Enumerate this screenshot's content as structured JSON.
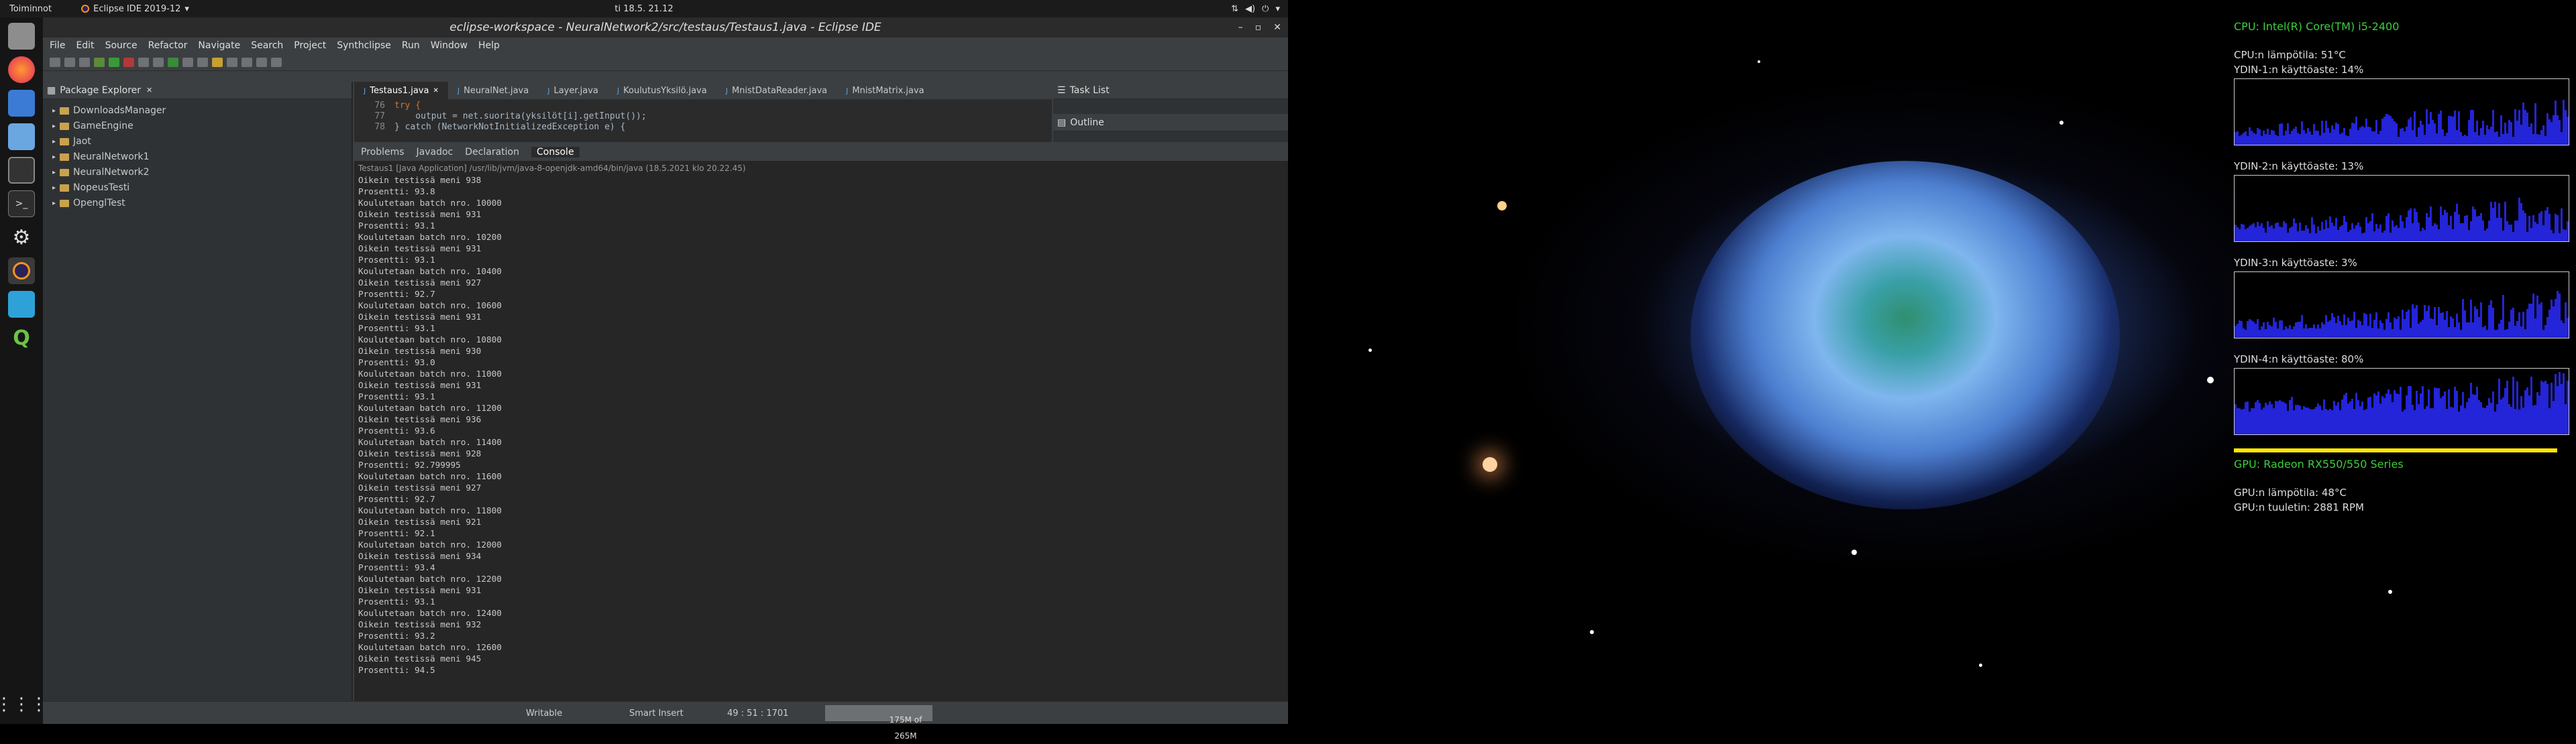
{
  "topbar": {
    "activities": "Toiminnot",
    "app_menu": "Eclipse IDE 2019-12",
    "clock": "ti 18.5.  21.12"
  },
  "window": {
    "title": "eclipse-workspace - NeuralNetwork2/src/testaus/Testaus1.java - Eclipse IDE"
  },
  "menubar": [
    "File",
    "Edit",
    "Source",
    "Refactor",
    "Navigate",
    "Search",
    "Project",
    "Synthclipse",
    "Run",
    "Window",
    "Help"
  ],
  "package_explorer": {
    "title": "Package Explorer",
    "projects": [
      "DownloadsManager",
      "GameEngine",
      "Jaot",
      "NeuralNetwork1",
      "NeuralNetwork2",
      "NopeusTesti",
      "OpenglTest"
    ]
  },
  "editor": {
    "tabs": [
      "Testaus1.java",
      "NeuralNet.java",
      "Layer.java",
      "KoulutusYksilö.java",
      "MnistDataReader.java",
      "MnistMatrix.java"
    ],
    "lines": [
      {
        "n": "76",
        "text": "try {"
      },
      {
        "n": "77",
        "text": "    output = net.suorita(yksilöt[i].getInput());"
      },
      {
        "n": "78",
        "text": "} catch (NetworkNotInitializedException e) {"
      }
    ]
  },
  "side": {
    "task_list": "Task List",
    "outline": "Outline"
  },
  "console": {
    "tabs": [
      "Problems",
      "Javadoc",
      "Declaration",
      "Console"
    ],
    "header": "Testaus1 [Java Application] /usr/lib/jvm/java-8-openjdk-amd64/bin/java (18.5.2021 klo 20.22.45)",
    "lines": [
      "Oikein testissä meni 938",
      "Prosentti: 93.8",
      "Koulutetaan batch nro. 10000",
      "Oikein testissä meni 931",
      "Prosentti: 93.1",
      "Koulutetaan batch nro. 10200",
      "Oikein testissä meni 931",
      "Prosentti: 93.1",
      "Koulutetaan batch nro. 10400",
      "Oikein testissä meni 927",
      "Prosentti: 92.7",
      "Koulutetaan batch nro. 10600",
      "Oikein testissä meni 931",
      "Prosentti: 93.1",
      "Koulutetaan batch nro. 10800",
      "Oikein testissä meni 930",
      "Prosentti: 93.0",
      "Koulutetaan batch nro. 11000",
      "Oikein testissä meni 931",
      "Prosentti: 93.1",
      "Koulutetaan batch nro. 11200",
      "Oikein testissä meni 936",
      "Prosentti: 93.6",
      "Koulutetaan batch nro. 11400",
      "Oikein testissä meni 928",
      "Prosentti: 92.799995",
      "Koulutetaan batch nro. 11600",
      "Oikein testissä meni 927",
      "Prosentti: 92.7",
      "Koulutetaan batch nro. 11800",
      "Oikein testissä meni 921",
      "Prosentti: 92.1",
      "Koulutetaan batch nro. 12000",
      "Oikein testissä meni 934",
      "Prosentti: 93.4",
      "Koulutetaan batch nro. 12200",
      "Oikein testissä meni 931",
      "Prosentti: 93.1",
      "Koulutetaan batch nro. 12400",
      "Oikein testissä meni 932",
      "Prosentti: 93.2",
      "Koulutetaan batch nro. 12600",
      "Oikein testissä meni 945",
      "Prosentti: 94.5"
    ]
  },
  "status": {
    "writable": "Writable",
    "insert": "Smart Insert",
    "position": "49 : 51 : 1701",
    "heap": "175M of 265M"
  },
  "monitor": {
    "cpu_name": "CPU: Intel(R) Core(TM) i5-2400",
    "cpu_temp": "CPU:n lämpötila: 51°C",
    "cores": [
      {
        "label": "YDIN-1:n käyttöaste: 14%"
      },
      {
        "label": "YDIN-2:n käyttöaste: 13%"
      },
      {
        "label": "YDIN-3:n käyttöaste: 3%"
      },
      {
        "label": "YDIN-4:n käyttöaste: 80%"
      }
    ],
    "gpu_name": "GPU: Radeon RX550/550 Series",
    "gpu_temp": "GPU:n lämpötila: 48°C",
    "gpu_fan": "GPU:n tuuletin: 2881 RPM"
  },
  "colors": {
    "accent_green": "#3ad13a",
    "graph_blue": "#2424d8",
    "bar_yellow": "#ffe800"
  }
}
